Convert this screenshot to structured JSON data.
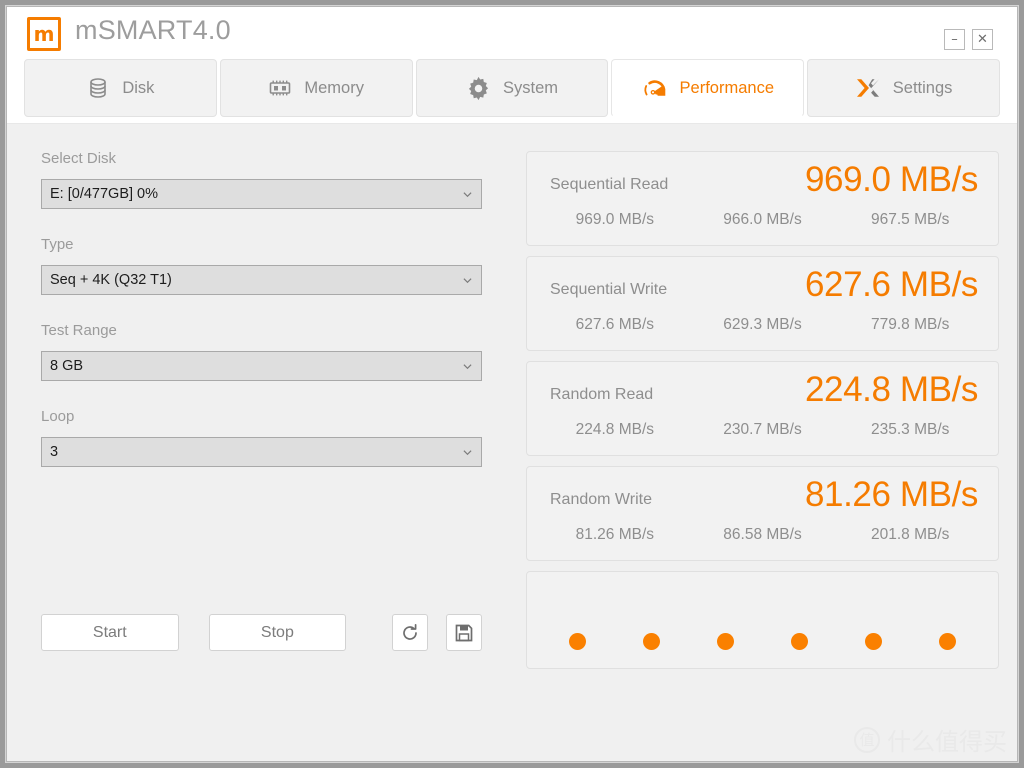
{
  "window": {
    "title": "mSMART4.0",
    "logo_glyph": "m",
    "minimize_label": "–",
    "close_label": "✕"
  },
  "tabs": [
    {
      "label": "Disk",
      "icon": "disk-icon",
      "active": false
    },
    {
      "label": "Memory",
      "icon": "memory-icon",
      "active": false
    },
    {
      "label": "System",
      "icon": "gear-icon",
      "active": false
    },
    {
      "label": "Performance",
      "icon": "speedometer-icon",
      "active": true
    },
    {
      "label": "Settings",
      "icon": "tools-x-icon",
      "active": false
    }
  ],
  "controls": {
    "select_disk": {
      "label": "Select Disk",
      "value": "E: [0/477GB] 0%"
    },
    "type": {
      "label": "Type",
      "value": "Seq + 4K (Q32 T1)"
    },
    "test_range": {
      "label": "Test Range",
      "value": "8 GB"
    },
    "loop": {
      "label": "Loop",
      "value": "3"
    }
  },
  "actions": {
    "start_label": "Start",
    "stop_label": "Stop",
    "refresh_icon": "refresh-icon",
    "save_icon": "save-floppy-icon"
  },
  "results": [
    {
      "title": "Sequential Read",
      "main": "969.0 MB/s",
      "subs": [
        "969.0 MB/s",
        "966.0 MB/s",
        "967.5 MB/s"
      ]
    },
    {
      "title": "Sequential Write",
      "main": "627.6 MB/s",
      "subs": [
        "627.6 MB/s",
        "629.3 MB/s",
        "779.8 MB/s"
      ]
    },
    {
      "title": "Random Read",
      "main": "224.8 MB/s",
      "subs": [
        "224.8 MB/s",
        "230.7 MB/s",
        "235.3 MB/s"
      ]
    },
    {
      "title": "Random Write",
      "main": "81.26 MB/s",
      "subs": [
        "81.26 MB/s",
        "86.58 MB/s",
        "201.8 MB/s"
      ]
    }
  ],
  "progress": {
    "dot_count": 6,
    "dot_color": "#fa8000"
  },
  "watermark": {
    "badge": "值",
    "text": "什么值得买"
  },
  "colors": {
    "accent": "#f57c00",
    "dot": "#fa8000",
    "muted_text": "#8e8e8e",
    "content_bg": "#f0f0f0"
  }
}
